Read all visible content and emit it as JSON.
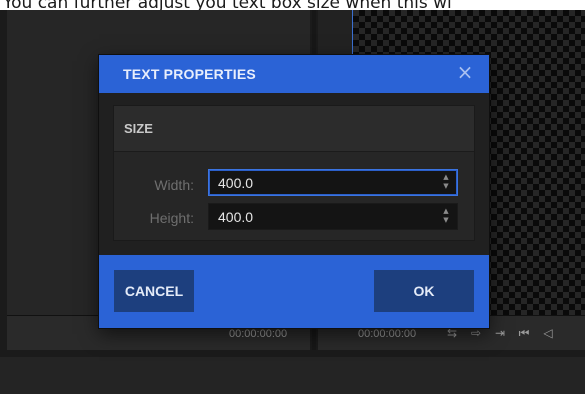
{
  "caption": "You can further adjust you text box size when this wi",
  "dialog": {
    "title": "TEXT PROPERTIES",
    "close_glyph": "×",
    "section": {
      "title": "SIZE",
      "fields": [
        {
          "label": "Width:",
          "value": "400.0",
          "focused": true
        },
        {
          "label": "Height:",
          "value": "400.0",
          "focused": false
        }
      ]
    },
    "buttons": {
      "cancel": "CANCEL",
      "ok": "OK"
    }
  },
  "timeline": {
    "left_timecode": "00:00:00:00",
    "right_timecode": "00:00:00:00",
    "transport_icons": [
      "loop-icon",
      "export-icon",
      "import-icon",
      "skip-start-icon",
      "step-back-icon"
    ]
  },
  "colors": {
    "accent": "#2b63d6",
    "button": "#1d3f7e",
    "background": "#1b1b1b"
  }
}
